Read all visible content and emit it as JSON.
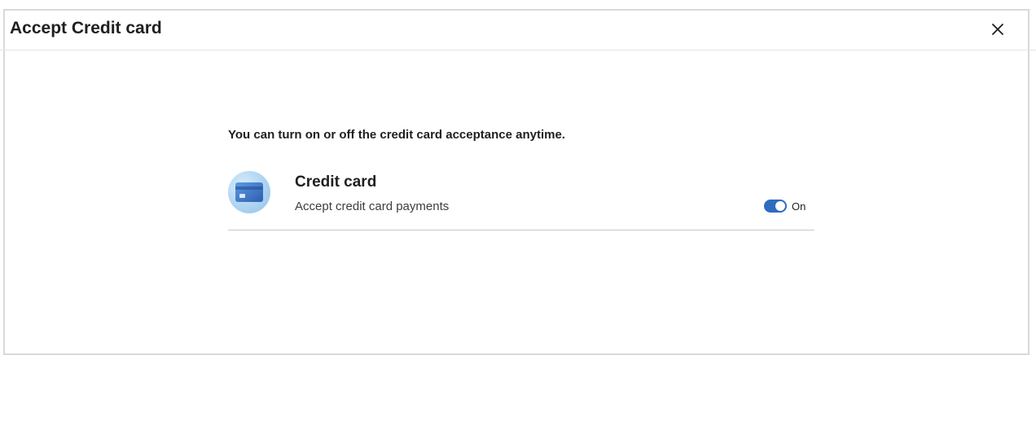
{
  "dialog": {
    "title": "Accept Credit card",
    "close_icon": "close-icon"
  },
  "content": {
    "intro": "You can turn on or off the credit card acceptance anytime.",
    "option": {
      "icon": "credit-card-icon",
      "title": "Credit card",
      "subtitle": "Accept credit card payments",
      "toggle": {
        "state": "on",
        "label": "On",
        "color": "#2f6bbf"
      }
    }
  }
}
